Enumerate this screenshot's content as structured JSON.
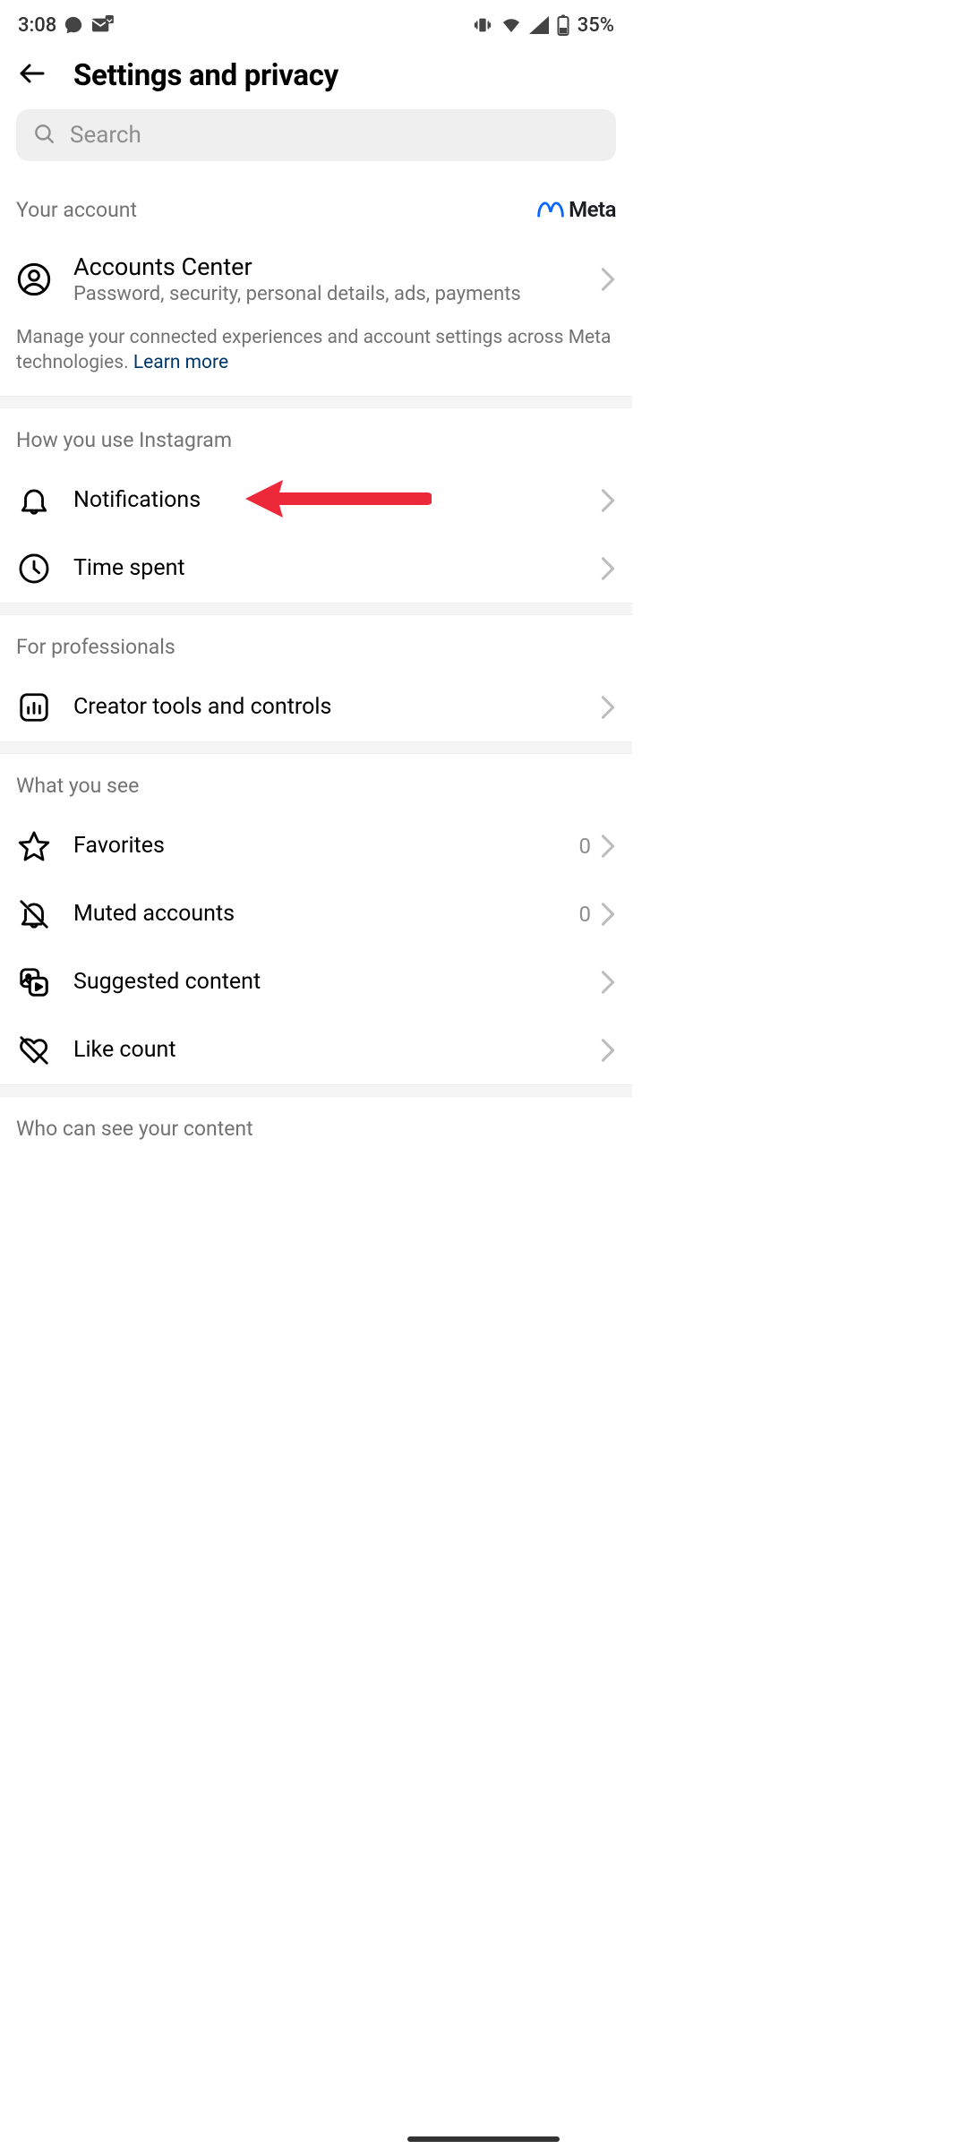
{
  "status_bar": {
    "time": "3:08",
    "battery_text": "35%"
  },
  "header": {
    "title": "Settings and privacy"
  },
  "search": {
    "placeholder": "Search"
  },
  "sections": {
    "your_account": {
      "title": "Your account",
      "meta_brand": "Meta",
      "accounts_center": {
        "title": "Accounts Center",
        "subtitle": "Password, security, personal details, ads, payments"
      },
      "desc_text": "Manage your connected experiences and account settings across Meta technologies. ",
      "learn_more": "Learn more"
    },
    "how_you_use": {
      "title": "How you use Instagram",
      "notifications": "Notifications",
      "time_spent": "Time spent"
    },
    "professionals": {
      "title": "For professionals",
      "creator_tools": "Creator tools and controls"
    },
    "what_you_see": {
      "title": "What you see",
      "favorites": "Favorites",
      "favorites_count": "0",
      "muted": "Muted accounts",
      "muted_count": "0",
      "suggested": "Suggested content",
      "like_count": "Like count"
    },
    "who_can_see": {
      "title": "Who can see your content"
    }
  }
}
